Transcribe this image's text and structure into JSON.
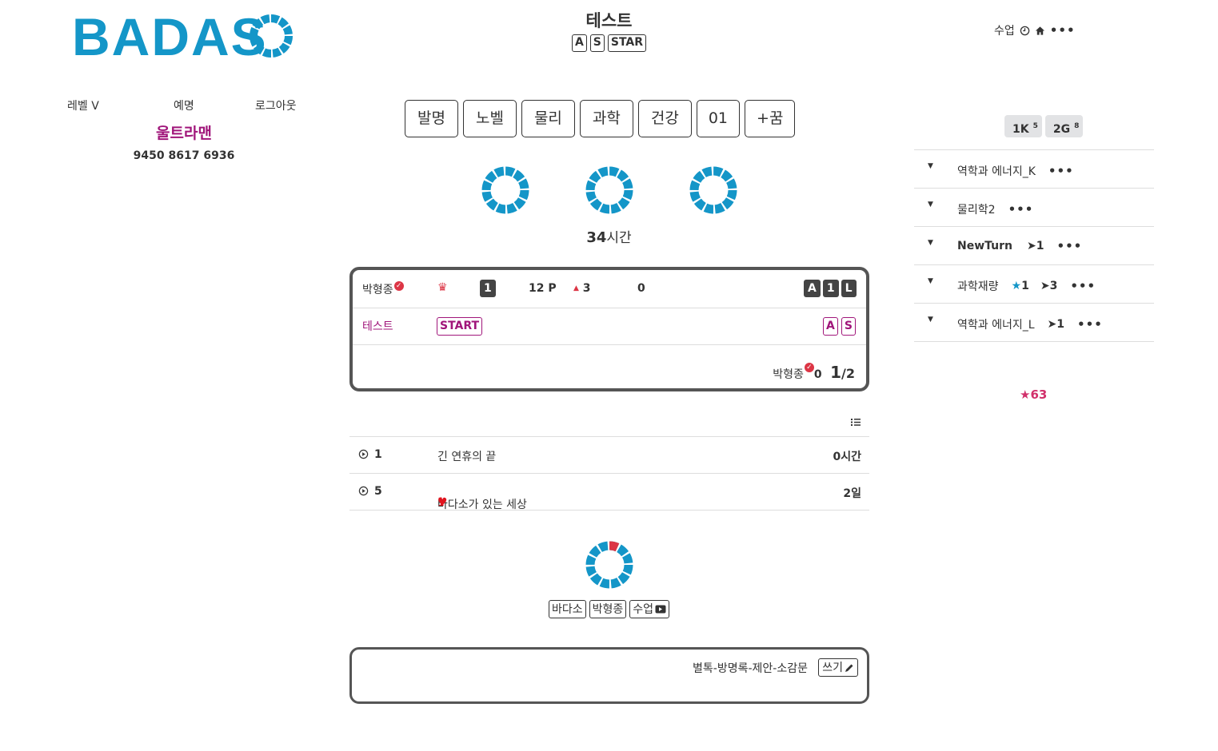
{
  "logo": {
    "text": "BADASO",
    "color": "#1496c8"
  },
  "header": {
    "title": "테스트",
    "badges": [
      "A",
      "S",
      "STAR"
    ],
    "right_label": "수업",
    "clock_icon": "clock-icon",
    "home_icon": "home-icon"
  },
  "profile": {
    "level": "레벨 V",
    "honor": "예명",
    "logout": "로그아웃",
    "nickname": "울트라맨",
    "number": "9450 8617 6936"
  },
  "nav": [
    "발명",
    "노벨",
    "물리",
    "과학",
    "건강",
    "01",
    "+꿈"
  ],
  "hours": {
    "value": "34",
    "unit": "시간"
  },
  "card": {
    "row1": {
      "name": "박형종",
      "crown": "♛",
      "num_badge": "1",
      "points": "12 P",
      "up_arrow": "▲",
      "up_value": "3",
      "zero": "0",
      "right_badges": [
        "A",
        "1",
        "L"
      ]
    },
    "row2": {
      "name": "테스트",
      "start": "START",
      "right_badges": [
        "A",
        "S"
      ]
    },
    "row3": {
      "name": "박형종",
      "count": "0",
      "ratio_big": "1",
      "ratio_rest": "/2"
    }
  },
  "list": [
    {
      "num": "1",
      "title": "긴 연휴의 끝",
      "heart": "",
      "time": "0시간"
    },
    {
      "num": "5",
      "title": "바다소가 있는 세상",
      "heart": "1",
      "time": "2일"
    }
  ],
  "bottom_badges": [
    "바다소",
    "박형종",
    "수업"
  ],
  "card2": {
    "links": "별톡-방명록-제안-소감문",
    "write": "쓰기"
  },
  "right": {
    "k": "1K",
    "k_sup": "5",
    "g": "2G",
    "g_sup": "8",
    "items": [
      {
        "label": "역학과 에너지_K",
        "star": "",
        "arrow": ""
      },
      {
        "label": "물리학2",
        "star": "",
        "arrow": ""
      },
      {
        "label": "NewTurn",
        "star": "",
        "arrow": "1"
      },
      {
        "label": "과학재량",
        "star": "1",
        "arrow": "3"
      },
      {
        "label": "역학과 에너지_L",
        "star": "",
        "arrow": "1"
      }
    ],
    "stars": "63"
  },
  "colors": {
    "accent": "#1496c8",
    "magenta": "#a0157a",
    "red": "#dc3545"
  }
}
